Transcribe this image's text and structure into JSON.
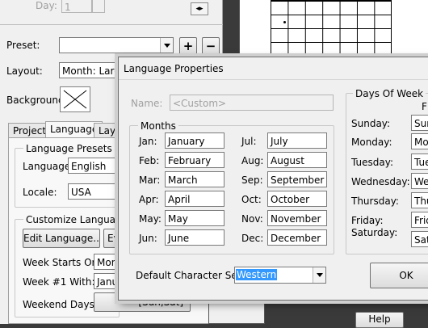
{
  "background_panel": {
    "day_label": "Day:",
    "day_value": "1",
    "preset_label": "Preset:",
    "preset_value": "",
    "add_label": "+",
    "remove_label": "−",
    "layout_label": "Layout:",
    "layout_value": "Month: Large",
    "background_label": "Background:",
    "tabs": [
      {
        "label": "Project"
      },
      {
        "label": "Language"
      },
      {
        "label": "Layo"
      }
    ],
    "language_presets_title": "Language Presets",
    "language_label": "Language:",
    "language_value": "English",
    "locale_label": "Locale:",
    "locale_value": "USA",
    "customize_title": "Customize Language Se",
    "edit_language_label": "Edit Language...",
    "ev_label": "Ev",
    "week_starts_label": "Week Starts On:",
    "week_starts_value": "Mond",
    "week1_label": "Week #1 With:",
    "week1_value": "Janu",
    "weekend_label": "Weekend Days:",
    "weekend_value": "[Sun,Sat]",
    "help_label": "Help"
  },
  "dialog": {
    "title": "Language Properties",
    "name_label": "Name:",
    "name_placeholder": "<Custom>",
    "months_title": "Months",
    "months": [
      {
        "abbr": "Jan:",
        "name": "January"
      },
      {
        "abbr": "Feb:",
        "name": "February"
      },
      {
        "abbr": "Mar:",
        "name": "March"
      },
      {
        "abbr": "Apr:",
        "name": "April"
      },
      {
        "abbr": "May:",
        "name": "May"
      },
      {
        "abbr": "Jun:",
        "name": "June"
      },
      {
        "abbr": "Jul:",
        "name": "July"
      },
      {
        "abbr": "Aug:",
        "name": "August"
      },
      {
        "abbr": "Sep:",
        "name": "September"
      },
      {
        "abbr": "Oct:",
        "name": "October"
      },
      {
        "abbr": "Nov:",
        "name": "November"
      },
      {
        "abbr": "Dec:",
        "name": "December"
      }
    ],
    "days_title": "Days Of Week",
    "days_col_header": "F",
    "days": [
      {
        "label": "Sunday:",
        "value": "Sun"
      },
      {
        "label": "Monday:",
        "value": "Mo"
      },
      {
        "label": "Tuesday:",
        "value": "Tue"
      },
      {
        "label": "Wednesday:",
        "value": "Wed"
      },
      {
        "label": "Thursday:",
        "value": "Thu"
      },
      {
        "label": "Friday:",
        "value": "Frid"
      },
      {
        "label": "Saturday:",
        "value": "Satu"
      }
    ],
    "charset_label": "Default Character Set:",
    "charset_value": "Western",
    "ok_label": "OK"
  }
}
